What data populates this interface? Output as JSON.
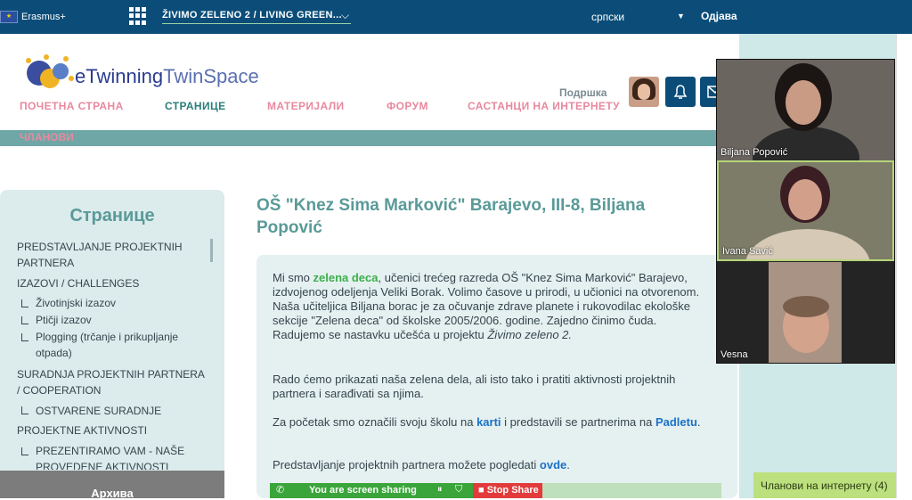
{
  "topbar": {
    "erasmus_label": "Erasmus+",
    "project_title": "ŽIVIMO ZELENO 2 / LIVING GREEN...",
    "language": "српски",
    "logout": "Одјава"
  },
  "header": {
    "logo_text_e": "e",
    "logo_text_main": "Twinning",
    "logo_text_tail": "TwinSpace",
    "support": "Подршка"
  },
  "nav": {
    "items": [
      "ПОЧЕТНА СТРАНА",
      "СТРАНИЦЕ",
      "МАТЕРИЈАЛИ",
      "ФОРУМ",
      "САСТАНЦИ НА ИНТЕРНЕТУ"
    ],
    "members": "ЧЛАНОВИ"
  },
  "sidebar": {
    "title": "Странице",
    "items": [
      "PREDSTAVLJANJE PROJEKTNIH PARTNERA",
      "IZAZOVI / CHALLENGES",
      "Životinjski izazov",
      "Ptičji izazov",
      "Plogging (trčanje i prikupljanje otpada)",
      "SURADNJA PROJEKTNIH PARTNERA / COOPERATION",
      "OSTVARENE SURADNJE",
      "PROJEKTNE AKTIVNOSTI",
      "PREZENTIRAMO VAM - NAŠE PROVEDENE AKTIVNOSTI"
    ],
    "archive": "Архива"
  },
  "content": {
    "title": "OŠ \"Knez Sima Marković\" Barajevo, III-8, Biljana Popović",
    "p1_a": "Mi smo ",
    "p1_green": "zelena deca",
    "p1_b": ", učenici trećeg razreda OŠ \"Knez Sima Marković\" Barajevo, izdvojenog odeljenja Veliki Borak. Volimo časove u prirodi, u učionici na otvorenom. Naša učiteljica Biljana borac je za očuvanje zdrave planete i rukovodilac ekološke sekcije \"Zelena deca\" od školske 2005/2006. godine. Zajedno činimo čuda. Radujemo se nastavku učešća u projektu ",
    "p1_italic": "Živimo zeleno 2.",
    "p2": "Rado ćemo prikazati naša zelena dela, ali isto tako i pratiti aktivnosti projektnih partnera i sarađivati sa njima.",
    "p3_a": "Za početak smo označili svoju školu na ",
    "p3_link1": "karti",
    "p3_b": " i predstavili se partnerima na ",
    "p3_link2": "Padletu",
    "p3_c": ".",
    "p4_a": "Predstavljanje projektnih partnera možete pogledati ",
    "p4_link": "ovde",
    "p4_b": "."
  },
  "share": {
    "status": "You are screen sharing",
    "stop": "Stop Share"
  },
  "video": {
    "participants": [
      "Biljana Popović",
      "Ivana Savić",
      "Vesna"
    ]
  },
  "online_members": "Чланови на интернету (4)"
}
